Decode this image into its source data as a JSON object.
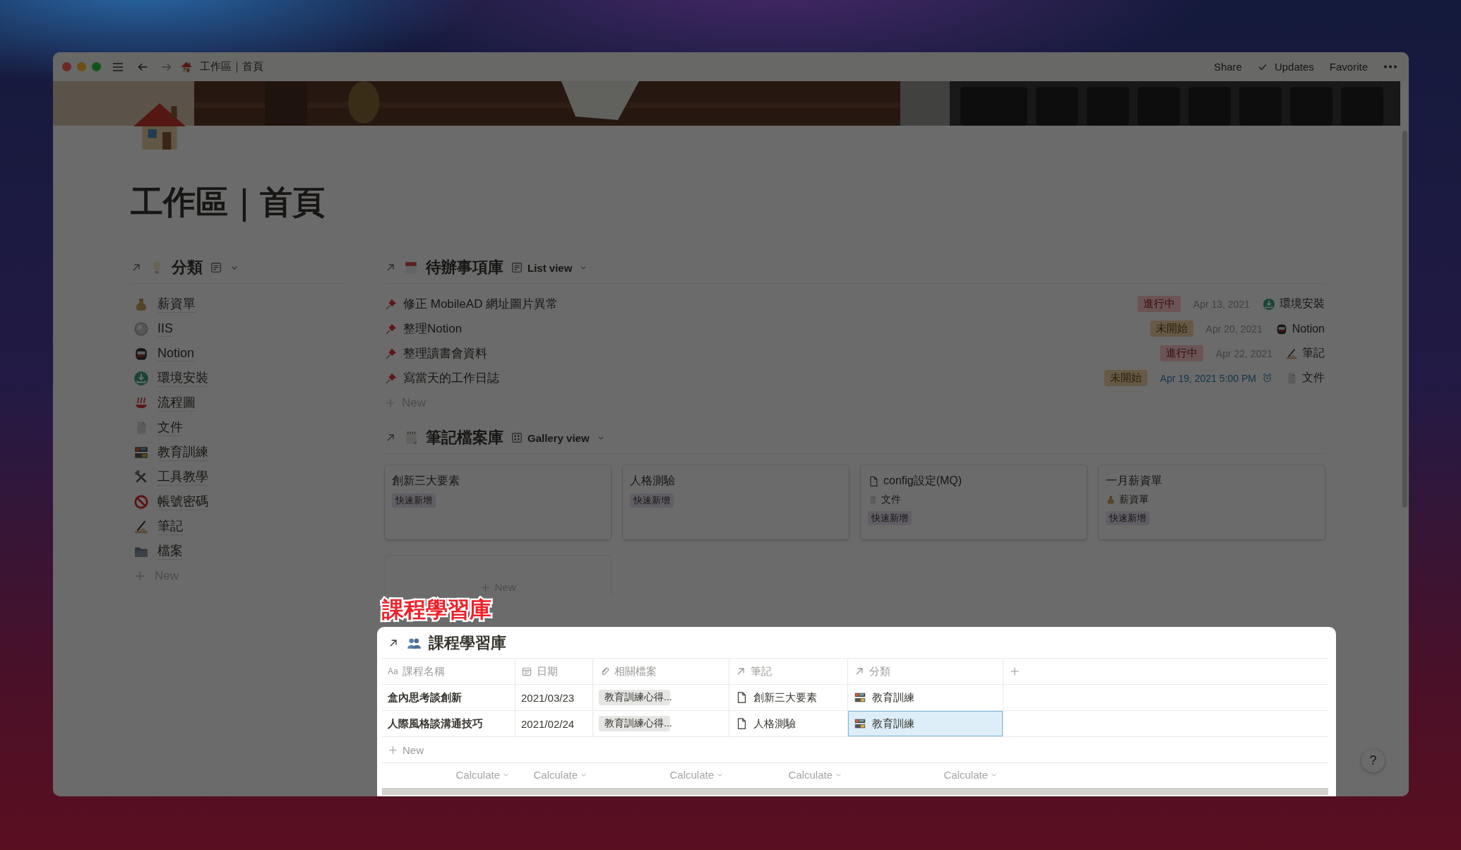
{
  "window": {
    "breadcrumb": "工作區｜首頁",
    "actions": [
      "Share",
      "Updates",
      "Favorite"
    ]
  },
  "page": {
    "title": "工作區｜首頁"
  },
  "categories": {
    "title": "分類",
    "new_label": "New",
    "items": [
      {
        "label": "薪資單"
      },
      {
        "label": "IIS"
      },
      {
        "label": "Notion"
      },
      {
        "label": "環境安裝"
      },
      {
        "label": "流程圖"
      },
      {
        "label": "文件"
      },
      {
        "label": "教育訓練"
      },
      {
        "label": "工具教學"
      },
      {
        "label": "帳號密碼"
      },
      {
        "label": "筆記"
      },
      {
        "label": "檔案"
      }
    ]
  },
  "todos": {
    "title": "待辦事項庫",
    "view": "List view",
    "new_label": "New",
    "items": [
      {
        "title": "修正 MobileAD 網址圖片異常",
        "status": {
          "label": "進行中",
          "kind": "in_progress"
        },
        "date": "Apr 13, 2021",
        "reminder": false,
        "category": "環境安裝"
      },
      {
        "title": "整理Notion",
        "status": {
          "label": "未開始",
          "kind": "not_started"
        },
        "date": "Apr 20, 2021",
        "reminder": false,
        "category": "Notion"
      },
      {
        "title": "整理讀書會資料",
        "status": {
          "label": "進行中",
          "kind": "in_progress"
        },
        "date": "Apr 22, 2021",
        "reminder": false,
        "category": "筆記"
      },
      {
        "title": "寫當天的工作日誌",
        "status": {
          "label": "未開始",
          "kind": "not_started"
        },
        "date": "Apr 19, 2021 5:00 PM",
        "reminder": true,
        "category": "文件"
      }
    ]
  },
  "notes": {
    "title": "筆記檔案庫",
    "view": "Gallery view",
    "new_label": "New",
    "cards": [
      {
        "title": "創新三大要素",
        "kind": "plain",
        "tag": "快速新增"
      },
      {
        "title": "人格測驗",
        "kind": "plain",
        "tag": "快速新增"
      },
      {
        "title": "config設定(MQ)",
        "kind": "doc",
        "category": "文件",
        "tag": "快速新增"
      },
      {
        "title": "一月薪資單",
        "kind": "plain",
        "category": "薪資單",
        "tag": "快速新增"
      }
    ]
  },
  "annotation": "課程學習庫",
  "courses": {
    "title": "課程學習庫",
    "new_label": "New",
    "columns": [
      {
        "label": "課程名稱",
        "kind": "text",
        "icon_text": "Aa"
      },
      {
        "label": "日期",
        "kind": "date"
      },
      {
        "label": "相關檔案",
        "kind": "file"
      },
      {
        "label": "筆記",
        "kind": "relation"
      },
      {
        "label": "分類",
        "kind": "relation"
      }
    ],
    "rows": [
      {
        "name": "盒內思考談創新",
        "date": "2021/03/23",
        "file": "教育訓練心得...",
        "note": "創新三大要素",
        "category": {
          "label": "教育訓練",
          "selected": false
        }
      },
      {
        "name": "人際風格談溝通技巧",
        "date": "2021/02/24",
        "file": "教育訓練心得...",
        "note": "人格測驗",
        "category": {
          "label": "教育訓練",
          "selected": true
        }
      }
    ],
    "footer": [
      "Calculate",
      "Calculate",
      "Calculate",
      "Calculate",
      "Calculate"
    ]
  },
  "help": "?"
}
